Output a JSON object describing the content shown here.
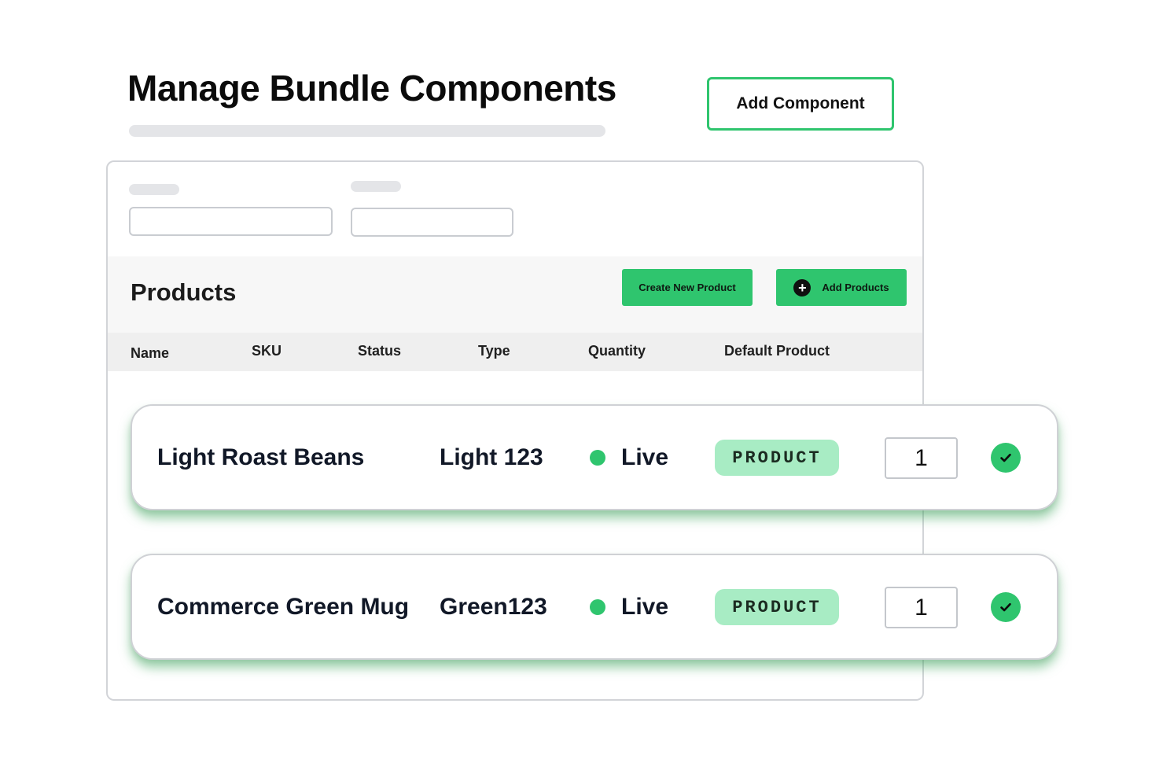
{
  "page": {
    "title": "Manage Bundle Components",
    "add_component_label": "Add Component"
  },
  "filters": {
    "first_value": "",
    "second_value": ""
  },
  "products": {
    "title": "Products",
    "create_new_label": "Create New Product",
    "add_products_label": "Add Products",
    "add_icon": "plus-circle-icon"
  },
  "table": {
    "columns": [
      "Name",
      "SKU",
      "Status",
      "Type",
      "Quantity",
      "Default Product"
    ],
    "rows": [
      {
        "name": "Light Roast Beans",
        "sku": "Light 123",
        "status": "Live",
        "type": "PRODUCT",
        "quantity": "1",
        "default_product": true
      },
      {
        "name": "Commerce Green Mug",
        "sku": "Green123",
        "status": "Live",
        "type": "PRODUCT",
        "quantity": "1",
        "default_product": true
      }
    ]
  },
  "colors": {
    "accent_green": "#2fc56e",
    "badge_green": "#a8ecc4",
    "status_live": "#2fc56e"
  },
  "icons": {
    "default_check": "check-circle-icon",
    "status_indicator": "status-dot-icon"
  }
}
